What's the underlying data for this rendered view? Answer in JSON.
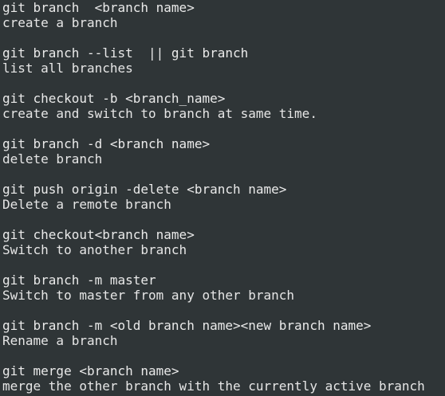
{
  "terminal": {
    "entries": [
      {
        "command": "git branch  <branch name>",
        "description": "create a branch"
      },
      {
        "command": "git branch --list  || git branch",
        "description": "list all branches"
      },
      {
        "command": "git checkout -b <branch_name>",
        "description": "create and switch to branch at same time."
      },
      {
        "command": "git branch -d <branch name>",
        "description": "delete branch"
      },
      {
        "command": "git push origin -delete <branch name>",
        "description": "Delete a remote branch"
      },
      {
        "command": "git checkout<branch name>",
        "description": "Switch to another branch"
      },
      {
        "command": "git branch -m master",
        "description": "Switch to master from any other branch"
      },
      {
        "command": "git branch -m <old branch name><new branch name>",
        "description": "Rename a branch"
      },
      {
        "command": "git merge <branch name>",
        "description": "merge the other branch with the currently active branch"
      }
    ]
  },
  "colors": {
    "background": "#2f3537",
    "text": "#e6e6e6"
  }
}
